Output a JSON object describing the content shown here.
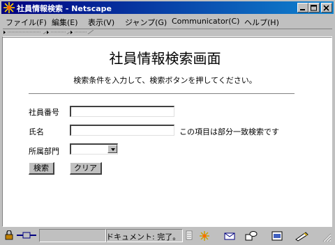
{
  "window": {
    "title": "社員情報検索 - Netscape"
  },
  "menu": [
    "ファイル(F)",
    "編集(E)",
    "表示(V)",
    "ジャンプ(G)",
    "Communicator(C)",
    "ヘルプ(H)"
  ],
  "page": {
    "title": "社員情報検索画面",
    "instruction": "検索条件を入力して、検索ボタンを押してください。",
    "fields": {
      "employee_no_label": "社員番号",
      "employee_no_value": "",
      "name_label": "氏名",
      "name_value": "",
      "name_note": "この項目は部分一致検索です",
      "dept_label": "所属部門",
      "dept_value": ""
    },
    "buttons": {
      "search": "検索",
      "clear": "クリア"
    }
  },
  "status": {
    "text": "ドキュメント: 完了。"
  },
  "colors": {
    "titlebar_start": "#000080",
    "titlebar_end": "#1084d0",
    "chrome": "#c0c0c0",
    "content_bg": "#ffffff"
  },
  "icons": [
    "netscape-app-icon",
    "minimize-icon",
    "maximize-icon",
    "close-icon",
    "lock-icon",
    "connection-icon",
    "netscape-status-icon",
    "mail-icon",
    "newsgroup-icon",
    "composer-icon",
    "address-book-icon",
    "pen-icon",
    "resize-grip-icon"
  ]
}
